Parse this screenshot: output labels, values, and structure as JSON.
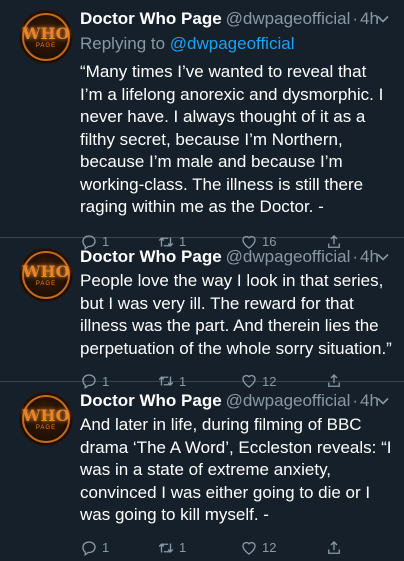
{
  "tweets": [
    {
      "avatar_text": "WHO",
      "avatar_sub": "PAGE",
      "name": "Doctor Who Page",
      "handle": "@dwpageofficial",
      "dot": "·",
      "time": "4h",
      "reply_prefix": "Replying to ",
      "reply_to": "@dwpageofficial",
      "text": "“Many times I’ve wanted to reveal that I’m a lifelong anorexic and dysmorphic. I never have. I always thought of it as a filthy secret, because I’m Northern, because I’m male and because I’m working-class. The illness is still there raging within me as the Doctor. -",
      "replies": "1",
      "retweets": "1",
      "likes": "16"
    },
    {
      "avatar_text": "WHO",
      "avatar_sub": "PAGE",
      "name": "Doctor Who Page",
      "handle": "@dwpageofficial",
      "dot": "·",
      "time": "4h",
      "text": "People love the way I look in that series, but I was very ill. The reward for that illness was the part. And therein lies the perpetuation of the whole sorry situation.”",
      "replies": "1",
      "retweets": "1",
      "likes": "12"
    },
    {
      "avatar_text": "WHO",
      "avatar_sub": "PAGE",
      "name": "Doctor Who Page",
      "handle": "@dwpageofficial",
      "dot": "·",
      "time": "4h",
      "text": "And later in life, during filming of BBC drama ‘The A Word’, Eccleston reveals: “I was in a state of extreme anxiety, convinced I was either going to die or I was going to kill myself. -",
      "replies": "1",
      "retweets": "1",
      "likes": "12"
    }
  ],
  "colors": {
    "background": "#15202b",
    "secondary_text": "#8899a6",
    "link": "#1da1f2",
    "divider": "#38444d",
    "avatar_accent": "#e8842a"
  },
  "icons": [
    "chevron-down-icon",
    "reply-icon",
    "retweet-icon",
    "like-icon",
    "share-icon"
  ]
}
